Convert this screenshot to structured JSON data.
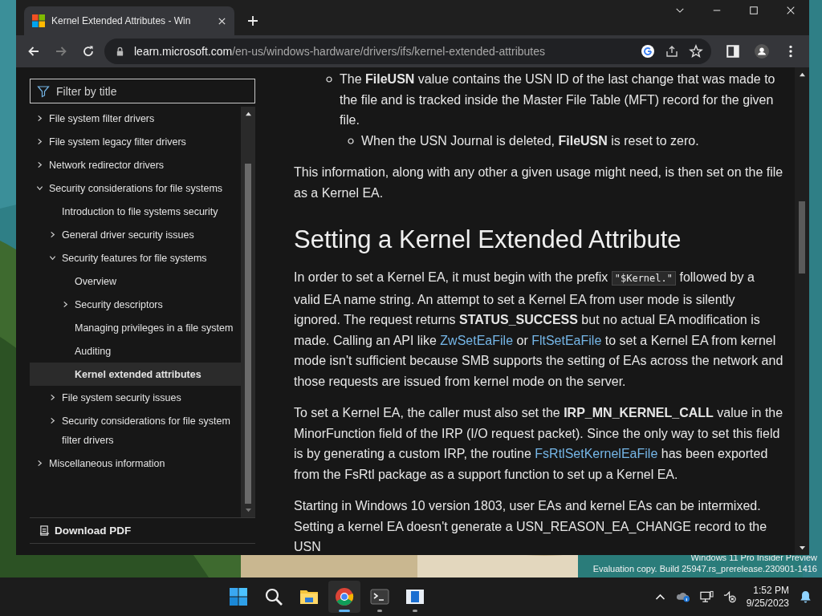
{
  "browser": {
    "tab": {
      "title": "Kernel Extended Attributes - Win"
    },
    "nav": [
      {
        "kind": "back",
        "disabled": false
      },
      {
        "kind": "forward",
        "disabled": true
      },
      {
        "kind": "reload",
        "disabled": false
      }
    ],
    "address": {
      "host": "learn.microsoft.com",
      "path": "/en-us/windows-hardware/drivers/ifs/kernel-extended-attributes"
    }
  },
  "sidebar": {
    "filter": {
      "placeholder": "Filter by title"
    },
    "items": [
      {
        "label": "File system filter drivers",
        "kind": "group",
        "expanded": false,
        "selected": false
      },
      {
        "label": "File system legacy filter drivers",
        "kind": "group",
        "expanded": false,
        "selected": false
      },
      {
        "label": "Network redirector drivers",
        "kind": "group",
        "expanded": false,
        "selected": false
      },
      {
        "label": "Security considerations for file systems",
        "kind": "group",
        "expanded": true,
        "selected": false,
        "children": [
          {
            "label": "Introduction to file systems security",
            "kind": "page",
            "selected": false
          },
          {
            "label": "General driver security issues",
            "kind": "group",
            "expanded": false,
            "selected": false
          },
          {
            "label": "Security features for file systems",
            "kind": "group",
            "expanded": true,
            "selected": false,
            "children": [
              {
                "label": "Overview",
                "kind": "page",
                "selected": false
              },
              {
                "label": "Security descriptors",
                "kind": "group",
                "expanded": false,
                "selected": false
              },
              {
                "label": "Managing privileges in a file system",
                "kind": "page",
                "selected": false
              },
              {
                "label": "Auditing",
                "kind": "page",
                "selected": false
              },
              {
                "label": "Kernel extended attributes",
                "kind": "page",
                "selected": true
              }
            ]
          },
          {
            "label": "File system security issues",
            "kind": "group",
            "expanded": false,
            "selected": false
          },
          {
            "label": "Security considerations for file system filter drivers",
            "kind": "group",
            "expanded": false,
            "selected": false
          }
        ]
      },
      {
        "label": "Miscellaneous information",
        "kind": "group",
        "expanded": false,
        "selected": false
      }
    ],
    "download": "Download PDF"
  },
  "article": [
    {
      "kind": "list",
      "items": [
        {
          "text": "The **FileUSN** value contains the USN ID of the last change that was made to the file and is tracked inside the Master File Table (MFT) record for the given file.",
          "children": [
            {
              "text": "When the USN Journal is deleted, **FileUSN** is reset to zero."
            }
          ]
        }
      ]
    },
    {
      "kind": "paragraph",
      "parts": [
        {
          "kind": "text",
          "text": "This information, along with any other a given usage might need, is then set on the file as a Kernel EA."
        }
      ]
    },
    {
      "kind": "heading",
      "text": "Setting a Kernel Extended Attribute"
    },
    {
      "kind": "paragraph",
      "parts": [
        {
          "kind": "text",
          "text": "In order to set a Kernel EA, it must begin with the prefix "
        },
        {
          "kind": "code",
          "text": "\"$Kernel.\""
        },
        {
          "kind": "text",
          "text": " followed by a valid EA name string. An attempt to set a Kernel EA from user mode is silently ignored. The request returns **STATUS_SUCCESS** but no actual EA modification is made. Calling an API like "
        },
        {
          "kind": "link",
          "text": "ZwSetEaFile"
        },
        {
          "kind": "text",
          "text": " or "
        },
        {
          "kind": "link",
          "text": "FltSetEaFile"
        },
        {
          "kind": "text",
          "text": " to set a Kernel EA from kernel mode isn't sufficient because SMB supports the setting of EAs across the network and those requests are issued from kernel mode on the server."
        }
      ]
    },
    {
      "kind": "paragraph",
      "parts": [
        {
          "kind": "text",
          "text": "To set a Kernel EA, the caller must also set the **IRP_MN_KERNEL_CALL** value in the MinorFunction field of the IRP (I/O request packet). Since the only way to set this field is by generating a custom IRP, the routine "
        },
        {
          "kind": "link",
          "text": "FsRtlSetKernelEaFile"
        },
        {
          "kind": "text",
          "text": " has been exported from the FsRtl package as a support function to set up a Kernel EA."
        }
      ]
    },
    {
      "kind": "paragraph",
      "parts": [
        {
          "kind": "text",
          "text": "Starting in Windows 10 version 1803, user EAs and kernel EAs can be intermixed. Setting a kernel EA doesn't generate a USN_REASON_EA_CHANGE record to the USN"
        }
      ]
    }
  ],
  "desktop": {
    "watermark": [
      "Windows 11 Pro Insider Preview",
      "Evaluation copy. Build 25947.rs_prerelease.230901-1416"
    ]
  },
  "taskbar": {
    "apps": [
      {
        "kind": "start",
        "selected": false,
        "running": false
      },
      {
        "kind": "search",
        "selected": false,
        "running": false
      },
      {
        "kind": "files",
        "selected": false,
        "running": false
      },
      {
        "kind": "chrome",
        "selected": true,
        "running": true
      },
      {
        "kind": "terminal",
        "selected": false,
        "running": true
      },
      {
        "kind": "reader",
        "selected": false,
        "running": true
      }
    ],
    "time": "1:52 PM",
    "date": "9/25/2023"
  }
}
